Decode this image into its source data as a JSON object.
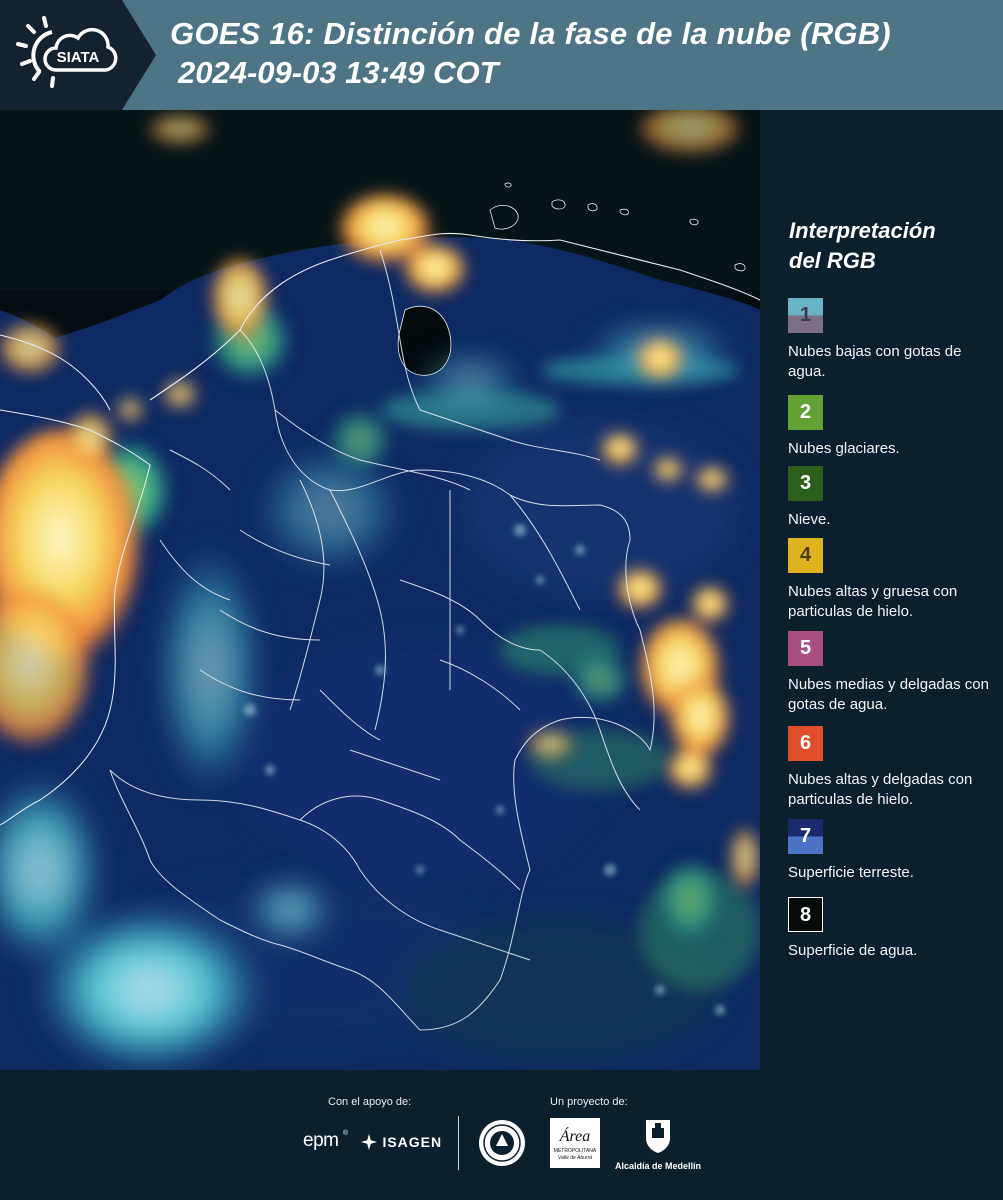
{
  "header": {
    "logo_text": "SIATA",
    "title_line1": "GOES 16: Distinción de la fase de la nube (RGB)",
    "title_line2": "2024-09-03 13:49 COT"
  },
  "legend": {
    "title_line1": "Interpretación",
    "title_line2": "del RGB",
    "items": [
      {
        "number": "1",
        "label": "Nubes bajas con gotas de agua.",
        "color_top": "#6ab3c6",
        "color_bottom": "#7c6f85"
      },
      {
        "number": "2",
        "label": "Nubes glaciares.",
        "color_top": "#63a135",
        "color_bottom": "#63a135"
      },
      {
        "number": "3",
        "label": "Nieve.",
        "color_top": "#2c5e1c",
        "color_bottom": "#2c5e1c"
      },
      {
        "number": "4",
        "label": "Nubes altas y gruesa con particulas de hielo.",
        "color_top": "#e1b21f",
        "color_bottom": "#e1b21f"
      },
      {
        "number": "5",
        "label": "Nubes medias y delgadas con gotas de agua.",
        "color_top": "#a84f80",
        "color_bottom": "#a84f80"
      },
      {
        "number": "6",
        "label": "Nubes altas y delgadas con particulas de hielo.",
        "color_top": "#e04e2b",
        "color_bottom": "#e04e2b"
      },
      {
        "number": "7",
        "label": "Superficie terreste.",
        "color_top": "#1b2a6c",
        "color_bottom": "#4d74c9"
      },
      {
        "number": "8",
        "label": "Superficie de agua.",
        "color_top": "#050b08",
        "color_bottom": "#050b08"
      }
    ]
  },
  "footer": {
    "support_caption": "Con el apoyo de:",
    "project_caption": "Un proyecto de:",
    "sponsor_epm": "epm",
    "sponsor_isagen": "ISAGEN",
    "area_logo_text": "Área",
    "area_logo_sub1": "METROPOLITANA",
    "area_logo_sub2": "Valle de Aburrá",
    "alcaldia_text": "Alcaldía de Medellín"
  },
  "colors": {
    "header_bg": "#4d7585",
    "logo_bg": "#13222e",
    "panel_bg": "#0b1f2d",
    "land": "#0f2a63",
    "ocean": "#040d12",
    "cloud_low": "#4ed6df",
    "cloud_high": "#f6e56a",
    "cloud_orange": "#f08a3c",
    "border_line": "#e8eef3"
  }
}
